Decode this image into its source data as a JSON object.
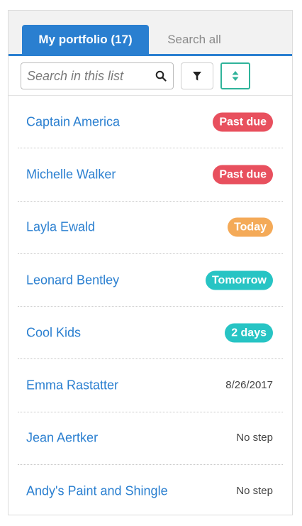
{
  "tabs": [
    {
      "label": "My portfolio (17)",
      "active": true
    },
    {
      "label": "Search all",
      "active": false
    }
  ],
  "search": {
    "placeholder": "Search in this list",
    "value": ""
  },
  "toolbar": {
    "filter_icon": "filter-icon",
    "sort_icon": "sort-icon"
  },
  "colors": {
    "primary": "#2a7fd0",
    "past_due": "#e8505e",
    "today": "#f4aa58",
    "upcoming": "#27c4c4",
    "sort_border": "#2fb39a"
  },
  "rows": [
    {
      "name": "Captain America",
      "status": "Past due",
      "kind": "badge",
      "color": "red"
    },
    {
      "name": "Michelle Walker",
      "status": "Past due",
      "kind": "badge",
      "color": "red"
    },
    {
      "name": "Layla Ewald",
      "status": "Today",
      "kind": "badge",
      "color": "orange"
    },
    {
      "name": "Leonard Bentley",
      "status": "Tomorrow",
      "kind": "badge",
      "color": "teal"
    },
    {
      "name": "Cool Kids",
      "status": "2 days",
      "kind": "badge",
      "color": "teal"
    },
    {
      "name": "Emma Rastatter",
      "status": "8/26/2017",
      "kind": "text",
      "color": ""
    },
    {
      "name": "Jean Aertker",
      "status": "No step",
      "kind": "text",
      "color": ""
    },
    {
      "name": "Andy's Paint and Shingle",
      "status": "No step",
      "kind": "text",
      "color": ""
    }
  ]
}
